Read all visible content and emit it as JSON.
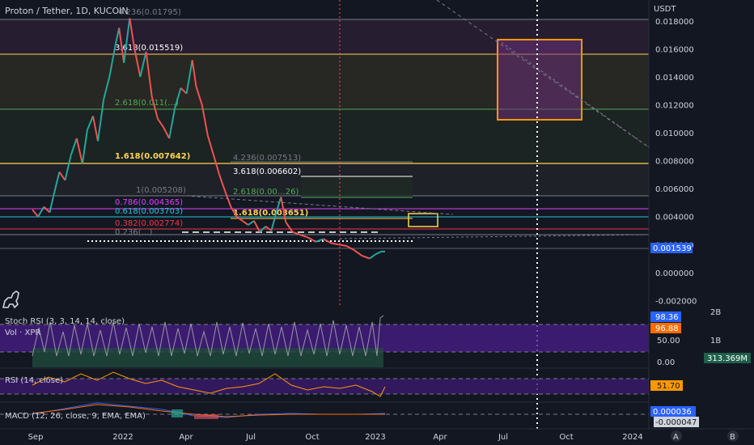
{
  "chart_data": {
    "type": "line",
    "title": "Proton / Tether, 1D, KUCOIN",
    "symbol_short": "XPR",
    "currency": "USDT",
    "x_ticks": [
      "Sep",
      "2022",
      "Apr",
      "Jul",
      "Oct",
      "2023",
      "Apr",
      "Jul",
      "Oct",
      "2024"
    ],
    "y_ticks": [
      "0.018000",
      "0.016000",
      "0.014000",
      "0.012000",
      "0.010000",
      "0.008000",
      "0.006000",
      "0.004000",
      "0.002000",
      "0.000000",
      "-0.002000"
    ],
    "ylim": [
      -0.0025,
      0.0195
    ],
    "price_tag": "0.001539",
    "price_series": [
      [
        0,
        0.0045
      ],
      [
        6,
        0.004
      ],
      [
        12,
        0.0047
      ],
      [
        18,
        0.0043
      ],
      [
        22,
        0.0055
      ],
      [
        28,
        0.0072
      ],
      [
        34,
        0.0066
      ],
      [
        40,
        0.0084
      ],
      [
        46,
        0.0096
      ],
      [
        52,
        0.0078
      ],
      [
        57,
        0.0102
      ],
      [
        63,
        0.0112
      ],
      [
        68,
        0.0094
      ],
      [
        74,
        0.0124
      ],
      [
        80,
        0.014
      ],
      [
        86,
        0.0162
      ],
      [
        90,
        0.0175
      ],
      [
        95,
        0.015
      ],
      [
        101,
        0.0182
      ],
      [
        106,
        0.016
      ],
      [
        112,
        0.014
      ],
      [
        118,
        0.0158
      ],
      [
        124,
        0.0126
      ],
      [
        130,
        0.011
      ],
      [
        136,
        0.0104
      ],
      [
        142,
        0.0096
      ],
      [
        148,
        0.0118
      ],
      [
        154,
        0.0132
      ],
      [
        160,
        0.0128
      ],
      [
        166,
        0.0152
      ],
      [
        170,
        0.0133
      ],
      [
        176,
        0.012
      ],
      [
        182,
        0.0098
      ],
      [
        188,
        0.0084
      ],
      [
        194,
        0.007
      ],
      [
        200,
        0.0058
      ],
      [
        206,
        0.0047
      ],
      [
        212,
        0.004
      ],
      [
        218,
        0.0037
      ],
      [
        224,
        0.0034
      ],
      [
        230,
        0.0037
      ],
      [
        236,
        0.0029
      ],
      [
        242,
        0.0033
      ],
      [
        248,
        0.003
      ],
      [
        254,
        0.0045
      ],
      [
        258,
        0.0054
      ],
      [
        263,
        0.0036
      ],
      [
        270,
        0.0029
      ],
      [
        278,
        0.0027
      ],
      [
        286,
        0.0025
      ],
      [
        294,
        0.0022
      ],
      [
        302,
        0.0024
      ],
      [
        310,
        0.0021
      ],
      [
        318,
        0.002
      ],
      [
        326,
        0.0019
      ],
      [
        334,
        0.0016
      ],
      [
        342,
        0.0012
      ],
      [
        350,
        0.001
      ],
      [
        356,
        0.0013
      ],
      [
        362,
        0.0015
      ],
      [
        366,
        0.0015
      ]
    ],
    "oscillators": [
      {
        "name": "Stoch RSI (3, 3, 14, 14, close)",
        "values": [
          "98.36",
          "96.88"
        ],
        "colors": [
          "#2962ff",
          "#ff6d00"
        ],
        "axis": [
          "50.00",
          "0.00"
        ]
      },
      {
        "name": "Vol · XPR",
        "value": "313.369M",
        "color": "#22ab94",
        "axis": [
          "2B",
          "1B"
        ]
      },
      {
        "name": "RSI (14, close)",
        "value": "51.70",
        "color": "#7e57c2"
      },
      {
        "name": "MACD (12, 26, close, 9, EMA, EMA)",
        "values": [
          "0.000036",
          "-0.000047"
        ],
        "colors": [
          "#2962ff",
          "#ff6d00"
        ]
      }
    ],
    "fib_labels": [
      {
        "text": "4.236(0.01795)",
        "color": "#787b86"
      },
      {
        "text": "3.618(0.015519)",
        "color": "#ffffff"
      },
      {
        "text": "2.618(0.011(…)",
        "color": "#4caf50"
      },
      {
        "text": "1.618(0.007642)",
        "color": "#ffd54f"
      },
      {
        "text": "1(0.005208)",
        "color": "#787b86"
      },
      {
        "text": "0.786(0.004365)",
        "color": "#e040fb"
      },
      {
        "text": "0.618(0.003703)",
        "color": "#26c6da"
      },
      {
        "text": "0.382(0.002774)",
        "color": "#f23645"
      },
      {
        "text": "0.236(…)",
        "color": "#787b86"
      },
      {
        "text": "4.236(0.007513)",
        "color": "#787b86"
      },
      {
        "text": "3.618(0.006602)",
        "color": "#ffffff"
      },
      {
        "text": "2.618(0.00…26)",
        "color": "#4caf50"
      },
      {
        "text": "1.618(0.003651)",
        "color": "#ffd54f"
      }
    ],
    "bottom_icons": [
      "A",
      "B"
    ]
  }
}
